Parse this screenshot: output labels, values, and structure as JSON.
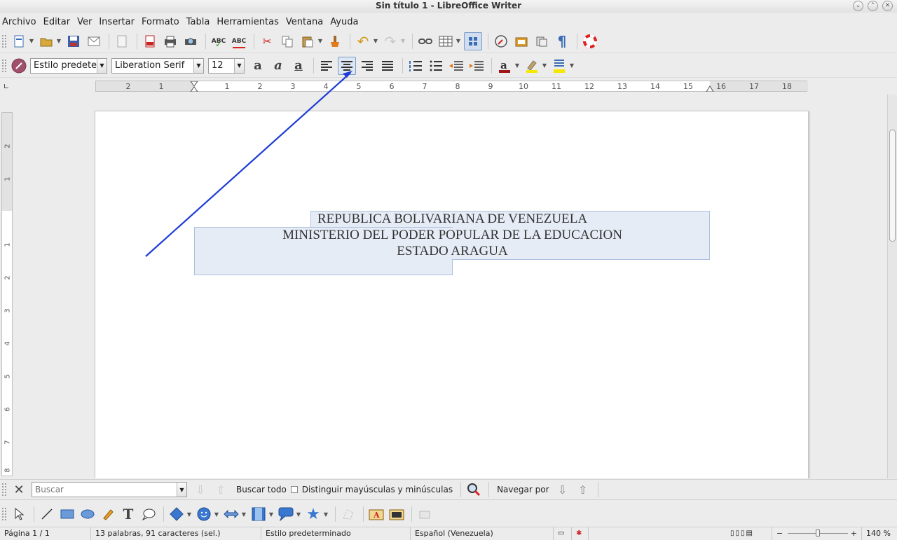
{
  "window": {
    "title": "Sin título 1 - LibreOffice Writer"
  },
  "menu": [
    "Archivo",
    "Editar",
    "Ver",
    "Insertar",
    "Formato",
    "Tabla",
    "Herramientas",
    "Ventana",
    "Ayuda"
  ],
  "formatting": {
    "para_style": "Estilo predeterm",
    "font_name": "Liberation Serif",
    "font_size": "12"
  },
  "ruler": {
    "labels": [
      "2",
      "1",
      "1",
      "2",
      "3",
      "4",
      "5",
      "6",
      "7",
      "8",
      "9",
      "10",
      "11",
      "12",
      "13",
      "14",
      "15",
      "16",
      "17",
      "18"
    ]
  },
  "vruler": {
    "labels": [
      "2",
      "1",
      "1",
      "2",
      "3",
      "4",
      "5",
      "6",
      "7",
      "8"
    ]
  },
  "document": {
    "lines": [
      "REPUBLICA BOLIVARIANA DE VENEZUELA",
      "MINISTERIO DEL PODER POPULAR DE LA EDUCACION",
      "ESTADO ARAGUA"
    ]
  },
  "find": {
    "placeholder": "Buscar",
    "find_all": "Buscar todo",
    "match_case": "Distinguir mayúsculas y minúsculas",
    "navigate": "Navegar por"
  },
  "status": {
    "page": "Página 1 / 1",
    "words": "13 palabras, 91 caracteres (sel.)",
    "style": "Estilo predeterminado",
    "language": "Español (Venezuela)",
    "zoom": "140 %"
  },
  "colors": {
    "accent": "#1e3cd6",
    "selection": "#e6ecf5"
  }
}
